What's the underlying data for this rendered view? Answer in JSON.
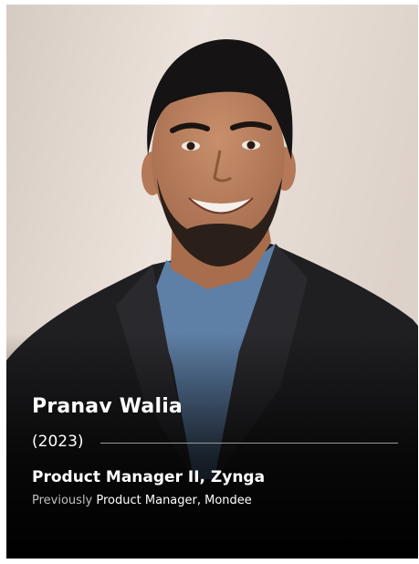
{
  "profile": {
    "name": "Pranav Walia",
    "year": "(2023)",
    "current_role": "Product Manager II, Zynga",
    "previous_label": "Previously",
    "previous_role": "Product Manager, Mondee"
  },
  "colors": {
    "background": "#e7ddd5",
    "card_bottom": "#000000",
    "text_primary": "#ffffff",
    "text_muted": "#bfbfbf"
  }
}
